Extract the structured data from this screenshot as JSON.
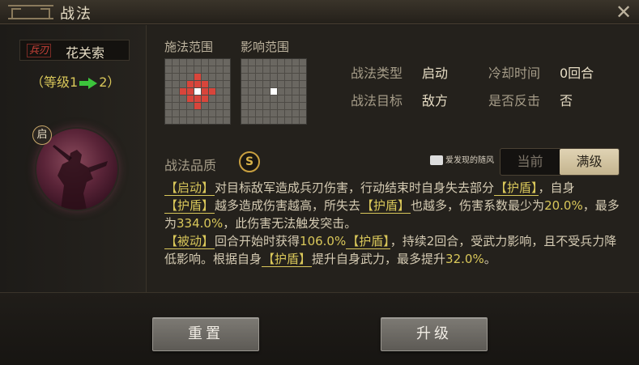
{
  "window": {
    "title": "战法",
    "close_icon": "close-icon"
  },
  "tactic": {
    "weapon_tag": "兵刃",
    "name": "花关索",
    "level_prefix": "（等级1",
    "level_suffix": "2）",
    "start_badge": "启"
  },
  "range": {
    "cast_label": "施法范围",
    "effect_label": "影响范围"
  },
  "info": {
    "type_label": "战法类型",
    "type_value": "启动",
    "cooldown_label": "冷却时间",
    "cooldown_value": "0回合",
    "target_label": "战法目标",
    "target_value": "敌方",
    "counter_label": "是否反击",
    "counter_value": "否"
  },
  "quality": {
    "label": "战法品质",
    "value": "S"
  },
  "watermark": "爱发现的随风",
  "toggle": {
    "current": "当前",
    "max": "满级",
    "selected": "max"
  },
  "description": {
    "p1_tag": "【启动】",
    "p1_a": "对目标敌军造成兵刃伤害，行动结束时自身失去部分",
    "p1_shield1": "【护盾】",
    "p1_b": "，自身",
    "p1_shield2": "【护盾】",
    "p1_c": "越多造成伤害越高，所失去",
    "p1_shield3": "【护盾】",
    "p1_d": "也越多，伤害系数最少为",
    "p1_min": "20.0%",
    "p1_e": "，最多为",
    "p1_max": "334.0%",
    "p1_f": "，此伤害无法触发突击。",
    "p2_tag": "【被动】",
    "p2_a": "回合开始时获得",
    "p2_val": "106.0%",
    "p2_shield1": "【护盾】",
    "p2_b": "，持续2回合，受武力影响，且不受兵力降低影响。根据自身",
    "p2_shield2": "【护盾】",
    "p2_c": "提升自身武力，最多提升",
    "p2_val2": "32.0%",
    "p2_d": "。"
  },
  "buttons": {
    "reset": "重置",
    "upgrade": "升级"
  },
  "colors": {
    "highlight": "#d9c75a",
    "range_red": "#d8453b",
    "arrow_green": "#3cc43c"
  }
}
